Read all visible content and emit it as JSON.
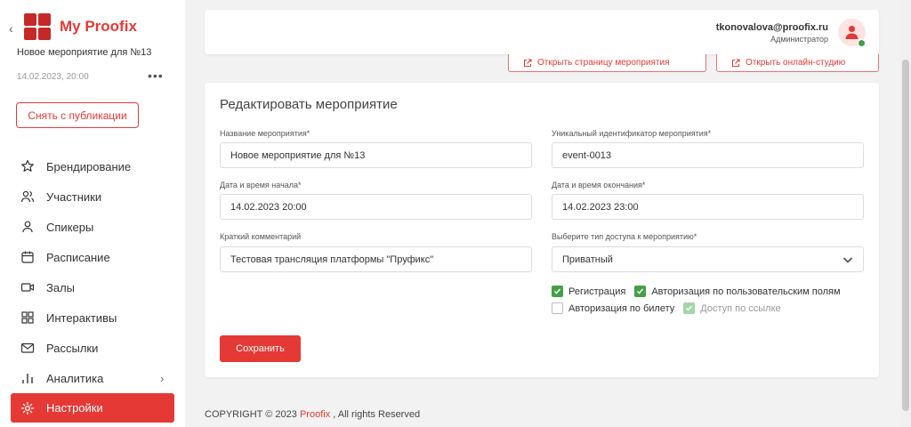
{
  "sidebar": {
    "app_title": "My Proofix",
    "event_name": "Новое мероприятие для №13",
    "event_date": "14.02.2023, 20:00",
    "more": "•••",
    "unpublish_label": "Снять с публикации",
    "items": [
      {
        "label": "Брендирование",
        "icon": "star-icon"
      },
      {
        "label": "Участники",
        "icon": "users-icon"
      },
      {
        "label": "Спикеры",
        "icon": "user-icon"
      },
      {
        "label": "Расписание",
        "icon": "calendar-icon"
      },
      {
        "label": "Залы",
        "icon": "video-icon"
      },
      {
        "label": "Интерактивы",
        "icon": "grid-icon"
      },
      {
        "label": "Рассылки",
        "icon": "mail-icon"
      },
      {
        "label": "Аналитика",
        "icon": "bar-chart-icon"
      },
      {
        "label": "Настройки",
        "icon": "gear-icon",
        "active": true
      }
    ]
  },
  "header": {
    "email": "tkonovalova@proofix.ru",
    "role": "Администратор"
  },
  "actions": {
    "open_page": "Открыть страницу мероприятия",
    "open_studio": "Открыть онлайн-студию"
  },
  "form": {
    "title": "Редактировать мероприятие",
    "name_label": "Название мероприятия*",
    "name_value": "Новое мероприятие для №13",
    "uid_label": "Уникальный идентификатор мероприятия*",
    "uid_value": "event-0013",
    "start_label": "Дата и время начала*",
    "start_value": "14.02.2023 20:00",
    "end_label": "Дата и время окончания*",
    "end_value": "14.02.2023 23:00",
    "comment_label": "Краткий комментарий",
    "comment_value": "Тестовая трансляция платформы \"Пруфикс\"",
    "access_label": "Выберите тип доступа к мероприятию*",
    "access_value": "Приватный",
    "checks": {
      "registration": "Регистрация",
      "auth_fields": "Авторизация по пользовательским полям",
      "auth_ticket": "Авторизация по билету",
      "link_access": "Доступ по ссылке"
    },
    "save_label": "Сохранить"
  },
  "footer": {
    "copyright": "COPYRIGHT © 2023",
    "brand": "Proofix",
    "rights": ", All rights Reserved"
  },
  "colors": {
    "accent": "#e53935",
    "check_green": "#43a047"
  }
}
